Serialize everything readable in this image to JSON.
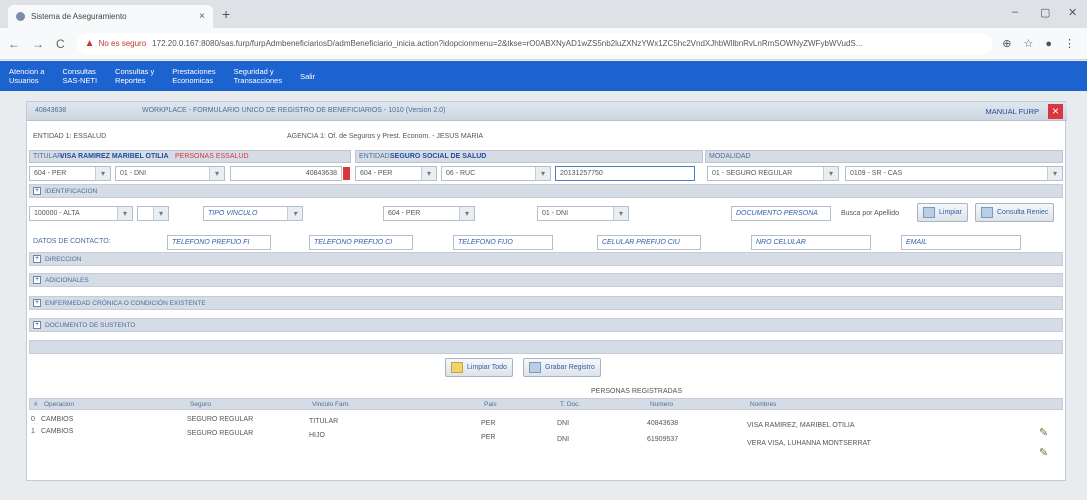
{
  "browser": {
    "tab_title": "Sistema de Aseguramiento",
    "tab_close": "×",
    "new_tab": "+",
    "not_secure": "No es seguro",
    "url": "172.20.0.167:8080/sas.furp/furpAdmbeneficiariosD/admBeneficiario_inicia.action?idopcionmenu=2&tkse=rO0ABXNyAD1wZS5nb2luZXNzYWx1ZC5hc2VndXJhbWllbnRvLnRmSOWNyZWFybWVudS..."
  },
  "menu": {
    "items": [
      "Atencion a\nUsuarios",
      "Consultas\nSAS-NETI",
      "Consultas y\nReportes",
      "Prestaciones\nEconomicas",
      "Seguridad y\nTransacciones",
      "Salir"
    ]
  },
  "form": {
    "code": "40843638",
    "title": "WORKPLACE - FORMULARIO UNICO DE REGISTRO DE BENEFICIARIOS - 1010 (Version 2.0)",
    "manual": "MANUAL FURP",
    "close": "×",
    "entidad": "ENTIDAD 1: ESSALUD",
    "agencia": "AGENCIA 1: Of. de Seguros y Prest. Econom. - JESUS MARIA",
    "titular_prefix": "TITULAR:",
    "titular_name": "VISA RAMIREZ MARIBEL OTILIA",
    "titular_tag": "PERSONAS ESSALUD",
    "entidad2_prefix": "ENTIDAD:",
    "entidad2_name": "SEGURO SOCIAL DE SALUD",
    "modalidad_label": "MODALIDAD",
    "titular_pais": "604 - PER",
    "titular_doc_type": "01 - DNI",
    "titular_doc_num": "40843638",
    "ent_pais": "604 - PER",
    "ent_doc_type": "06 - RUC",
    "ent_ruc": "20131257750",
    "modalidad": "01 - SEGURO REGULAR",
    "modalidad2": "0109 - SR - CAS",
    "identificacion": "IDENTIFICACION",
    "tipo_alta": "100000 - ALTA",
    "tipo_vinculo": "TIPO VINCULO",
    "ben_pais": "604 - PER",
    "ben_doc_type": "01 - DNI",
    "documento_persona": "DOCUMENTO PERSONA",
    "buscar_apellido": "Busca por Apellido",
    "limpiar": "Limpiar",
    "consulta_reniec": "Consulta Reniec",
    "datos_contacto": "DATOS DE CONTACTO:",
    "tel_fijo_a": "TELEFONO PREFIJO FI",
    "tel_fijo_c": "TELEFONO PREFIJO CI",
    "tel_fijo": "TELEFONO FIJO",
    "cel_prefijo": "CELULAR PREFIJO CIU",
    "nro_celular": "NRO CELULAR",
    "email": "EMAIL",
    "sections": [
      "DIRECCION",
      "ADICIONALES",
      "ENFERMEDAD CRÓNICA O CONDICIÓN EXISTENTE",
      "DOCUMENTO DE SUSTENTO"
    ],
    "limpiar_todo": "Limpiar Todo",
    "grabar": "Grabar Registro",
    "personas_registradas": "PERSONAS REGISTRADAS"
  },
  "table": {
    "headers": [
      "#",
      "Operacion",
      "Seguro",
      "Vinculo Fam.",
      "Pais",
      "T. Doc.",
      "Numero",
      "Nombres"
    ],
    "rows": [
      {
        "n": "0",
        "op": "CAMBIOS",
        "seguro": "SEGURO REGULAR",
        "vinculo": "TITULAR",
        "pais": "PER",
        "tdoc": "DNI",
        "numero": "40843638",
        "nombres": "VISA RAMIREZ, MARIBEL OTILIA"
      },
      {
        "n": "1",
        "op": "CAMBIOS",
        "seguro": "SEGURO REGULAR",
        "vinculo": "HIJO",
        "pais": "PER",
        "tdoc": "DNI",
        "numero": "61909537",
        "nombres": "VERA VISA, LUHANNA MONTSERRAT"
      }
    ]
  }
}
